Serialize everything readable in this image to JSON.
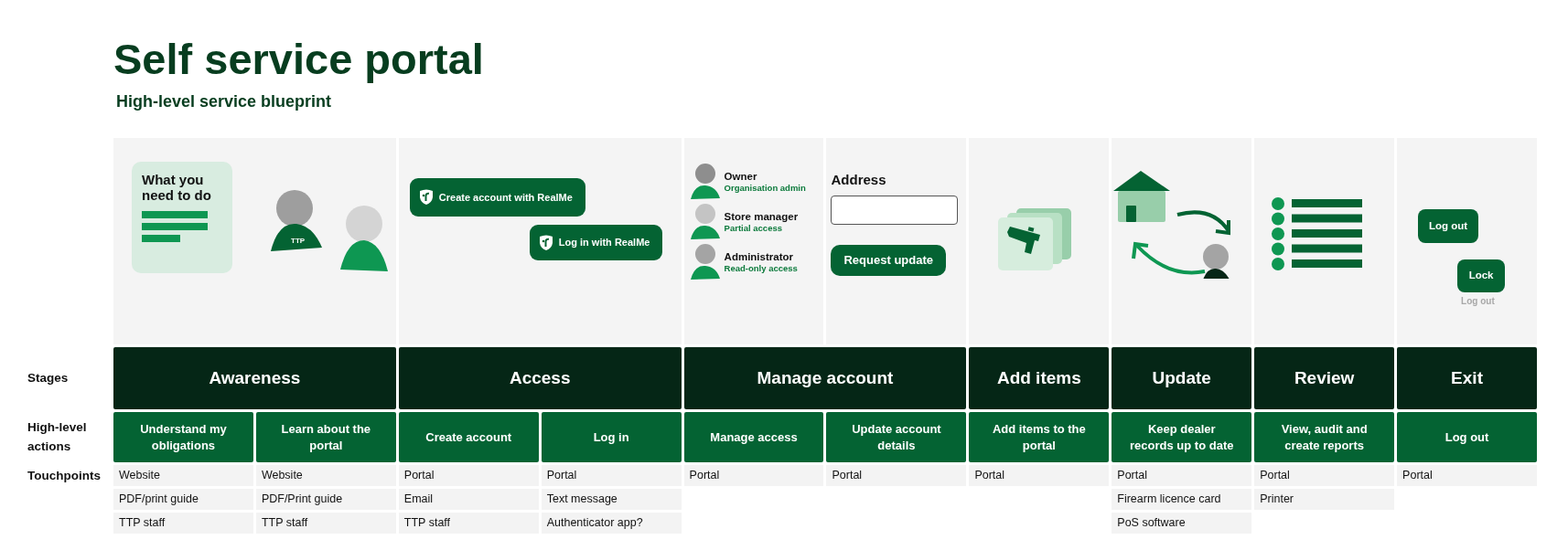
{
  "title": "Self service portal",
  "subtitle": "High-level service blueprint",
  "row_labels": [
    "Stages",
    "High-level actions",
    "Touchpoints"
  ],
  "stages": [
    {
      "label": "Awareness",
      "panels": [
        {
          "kind": "guide",
          "card_title": "What you need to do",
          "badge": "TTP"
        }
      ],
      "actions": [
        {
          "label": "Understand my obligations",
          "touchpoints": [
            "Website",
            "PDF/print guide",
            "TTP staff"
          ]
        },
        {
          "label": "Learn about the portal",
          "touchpoints": [
            "Website",
            "PDF/Print guide",
            "TTP staff"
          ]
        }
      ]
    },
    {
      "label": "Access",
      "panels": [
        {
          "kind": "realme",
          "buttons": [
            "Create account with RealMe",
            "Log in with RealMe"
          ]
        }
      ],
      "actions": [
        {
          "label": "Create account",
          "touchpoints": [
            "Portal",
            "Email",
            "TTP staff"
          ]
        },
        {
          "label": "Log in",
          "touchpoints": [
            "Portal",
            "Text message",
            "Authenticator app?"
          ]
        }
      ]
    },
    {
      "label": "Manage account",
      "panels": [
        {
          "kind": "roles",
          "roles": [
            {
              "name": "Owner",
              "access": "Organisation admin"
            },
            {
              "name": "Store manager",
              "access": "Partial access"
            },
            {
              "name": "Administrator",
              "access": "Read-only access"
            }
          ]
        },
        {
          "kind": "address",
          "label": "Address",
          "button": "Request update"
        }
      ],
      "actions": [
        {
          "label": "Manage access",
          "touchpoints": [
            "Portal"
          ]
        },
        {
          "label": "Update account details",
          "touchpoints": [
            "Portal"
          ]
        }
      ]
    },
    {
      "label": "Add items",
      "panels": [
        {
          "kind": "items"
        }
      ],
      "actions": [
        {
          "label": "Add items to the portal",
          "touchpoints": [
            "Portal"
          ]
        }
      ]
    },
    {
      "label": "Update",
      "panels": [
        {
          "kind": "sync"
        }
      ],
      "actions": [
        {
          "label": "Keep dealer records up to date",
          "touchpoints": [
            "Portal",
            "Firearm licence card",
            "PoS software"
          ]
        }
      ]
    },
    {
      "label": "Review",
      "panels": [
        {
          "kind": "list"
        }
      ],
      "actions": [
        {
          "label": "View, audit and create reports",
          "touchpoints": [
            "Portal",
            "Printer"
          ]
        }
      ]
    },
    {
      "label": "Exit",
      "panels": [
        {
          "kind": "exit",
          "buttons": [
            "Log out",
            "Lock"
          ],
          "caption": "Log out"
        }
      ],
      "actions": [
        {
          "label": "Log out",
          "touchpoints": [
            "Portal"
          ]
        }
      ]
    }
  ]
}
